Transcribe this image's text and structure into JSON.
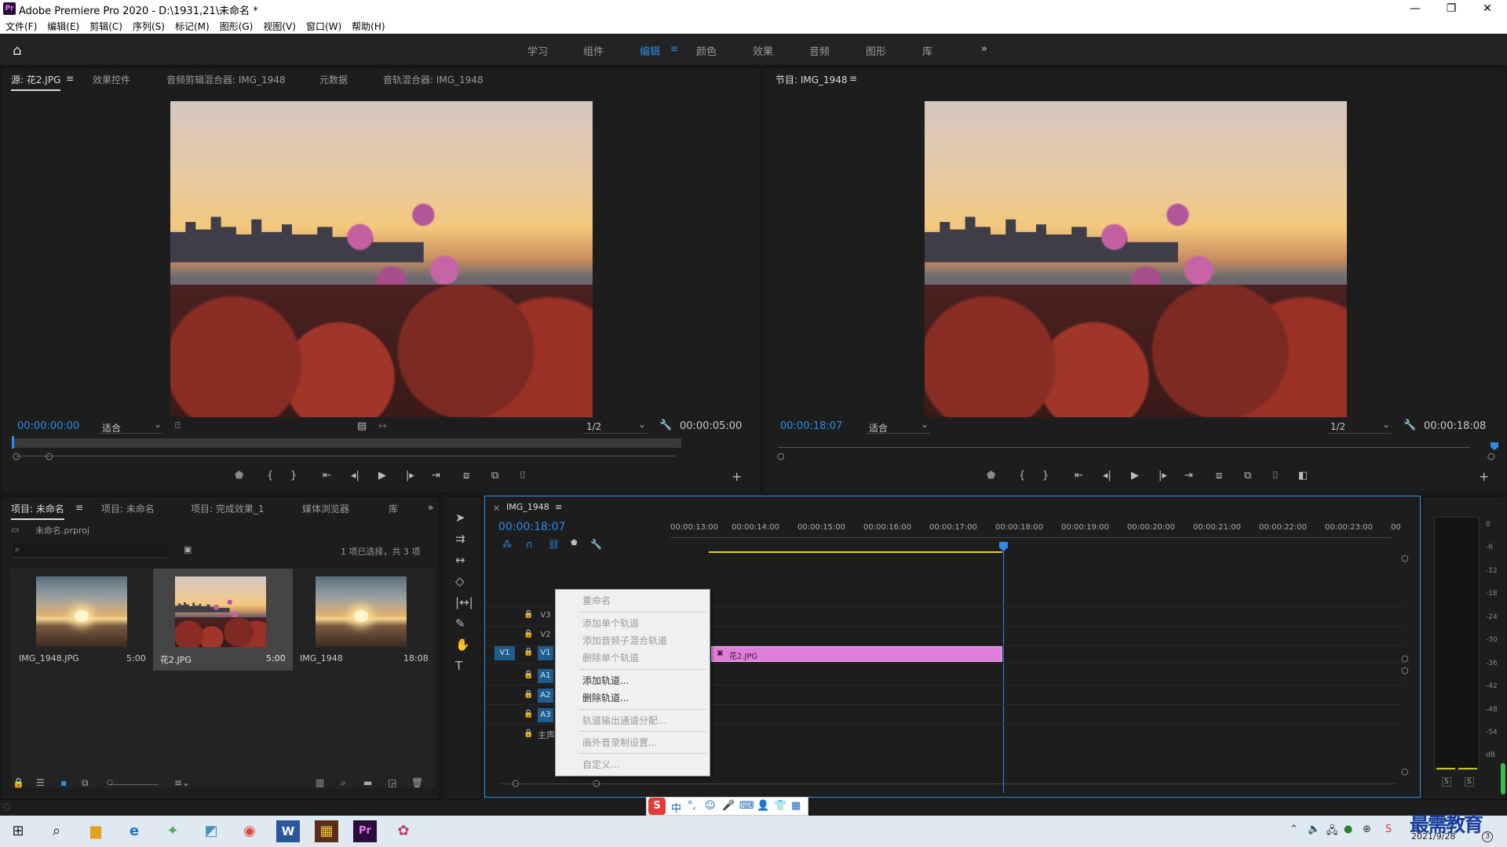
{
  "titlebar": {
    "title": "Adobe Premiere Pro 2020 - D:\\1931,21\\未命名 *",
    "minimize": "—",
    "restore": "❐",
    "close": "✕"
  },
  "menu": [
    "文件(F)",
    "编辑(E)",
    "剪辑(C)",
    "序列(S)",
    "标记(M)",
    "图形(G)",
    "视图(V)",
    "窗口(W)",
    "帮助(H)"
  ],
  "workspaces": {
    "items": [
      "学习",
      "组件",
      "编辑",
      "颜色",
      "效果",
      "音频",
      "图形",
      "库"
    ],
    "active": "编辑",
    "more": "»",
    "menu": "≡"
  },
  "source": {
    "tabs": [
      "源: 花2.JPG",
      "效果控件",
      "音频剪辑混合器: IMG_1948",
      "元数据",
      "音轨混合器: IMG_1948"
    ],
    "menu": "≡",
    "timecode": "00:00:00:00",
    "fit": "适合",
    "resolution": "1/2",
    "duration": "00:00:05:00"
  },
  "program": {
    "tab": "节目: IMG_1948",
    "menu": "≡",
    "timecode": "00:00:18:07",
    "fit": "适合",
    "resolution": "1/2",
    "duration": "00:00:18:08"
  },
  "project": {
    "tabs": [
      "项目: 未命名",
      "项目: 未命名",
      "项目: 完成效果_1",
      "媒体浏览器",
      "库"
    ],
    "menu": "≡",
    "more": "»",
    "file": "未命名.prproj",
    "status": "1 项已选择，共 3 项",
    "items": [
      {
        "name": "IMG_1948.JPG",
        "dur": "5:00"
      },
      {
        "name": "花2.JPG",
        "dur": "5:00"
      },
      {
        "name": "IMG_1948",
        "dur": "18:08"
      }
    ]
  },
  "timeline": {
    "tab": "IMG_1948",
    "close": "×",
    "menu": "≡",
    "timecode": "00:00:18:07",
    "ticks": [
      "00:00:13:00",
      "00:00:14:00",
      "00:00:15:00",
      "00:00:16:00",
      "00:00:17:00",
      "00:00:18:00",
      "00:00:19:00",
      "00:00:20:00",
      "00:00:21:00",
      "00:00:22:00",
      "00:00:23:00",
      "00"
    ],
    "tracks": [
      "V3",
      "V2",
      "V1",
      "A1",
      "A2",
      "A3"
    ],
    "source_patch": "V1",
    "master": "主声",
    "clip": "花2.JPG"
  },
  "context_menu": {
    "items": [
      {
        "label": "重命名",
        "enabled": false
      },
      {
        "label": "添加单个轨道",
        "enabled": false
      },
      {
        "label": "添加音频子混合轨道",
        "enabled": false
      },
      {
        "label": "删除单个轨道",
        "enabled": false
      },
      {
        "label": "添加轨道...",
        "enabled": true
      },
      {
        "label": "删除轨道...",
        "enabled": true
      },
      {
        "label": "轨道输出通道分配...",
        "enabled": false
      },
      {
        "label": "画外音录制设置...",
        "enabled": false
      },
      {
        "label": "自定义...",
        "enabled": false
      }
    ]
  },
  "audio_meter": {
    "scale": [
      "0",
      "-6",
      "-12",
      "-18",
      "-24",
      "-30",
      "-36",
      "-42",
      "-48",
      "-54",
      "dB"
    ],
    "solo_left": "S",
    "solo_right": "S"
  },
  "taskbar": {
    "date": "2021/9/28",
    "watermark": "最需教育"
  },
  "ime": {
    "labels": [
      "中",
      "°,",
      "☺",
      "🎤",
      "⌨",
      "👤",
      "👕",
      "▦"
    ]
  }
}
